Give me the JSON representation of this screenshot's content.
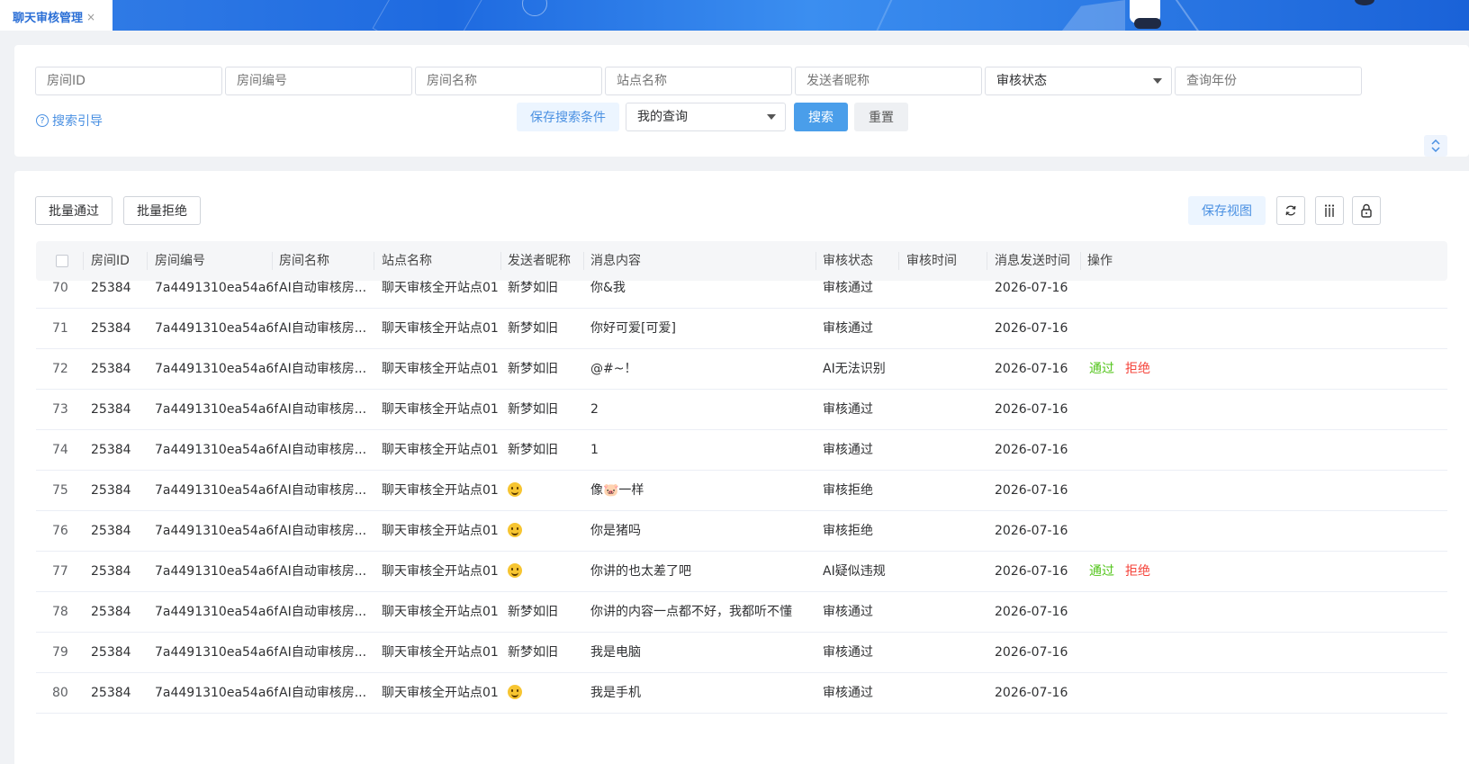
{
  "tab": {
    "title": "聊天审核管理",
    "close": "×"
  },
  "search": {
    "fields": [
      "房间ID",
      "房间编号",
      "房间名称",
      "站点名称",
      "发送者昵称",
      "审核状态",
      "查询年份"
    ],
    "guide": "搜索引导",
    "save_conditions": "保存搜索条件",
    "my_query": "我的查询",
    "search_button": "搜索",
    "reset_button": "重置",
    "collapse": "⌃⌄"
  },
  "toolbar": {
    "batch_pass": "批量通过",
    "batch_reject": "批量拒绝",
    "save_view": "保存视图"
  },
  "table": {
    "headers": [
      "房间ID",
      "房间编号",
      "房间名称",
      "站点名称",
      "发送者昵称",
      "消息内容",
      "审核状态",
      "审核时间",
      "消息发送时间",
      "操作"
    ],
    "actions": {
      "pass": "通过",
      "reject": "拒绝"
    },
    "rows": [
      {
        "idx": "70",
        "room_id": "25384",
        "room_no": "7a4491310ea54a6f",
        "room_name": "AI自动审核房...",
        "site": "聊天审核全开站点01",
        "sender": "新梦如旧",
        "sender_emoji": false,
        "content": "你&我",
        "status": "审核通过",
        "audit_time": "",
        "send_time": "2026-07-16",
        "has_actions": false
      },
      {
        "idx": "71",
        "room_id": "25384",
        "room_no": "7a4491310ea54a6f",
        "room_name": "AI自动审核房...",
        "site": "聊天审核全开站点01",
        "sender": "新梦如旧",
        "sender_emoji": false,
        "content": "你好可爱[可爱]",
        "status": "审核通过",
        "audit_time": "",
        "send_time": "2026-07-16",
        "has_actions": false
      },
      {
        "idx": "72",
        "room_id": "25384",
        "room_no": "7a4491310ea54a6f",
        "room_name": "AI自动审核房...",
        "site": "聊天审核全开站点01",
        "sender": "新梦如旧",
        "sender_emoji": false,
        "content": "@#~！",
        "status": "AI无法识别",
        "audit_time": "",
        "send_time": "2026-07-16",
        "has_actions": true
      },
      {
        "idx": "73",
        "room_id": "25384",
        "room_no": "7a4491310ea54a6f",
        "room_name": "AI自动审核房...",
        "site": "聊天审核全开站点01",
        "sender": "新梦如旧",
        "sender_emoji": false,
        "content": "2",
        "status": "审核通过",
        "audit_time": "",
        "send_time": "2026-07-16",
        "has_actions": false
      },
      {
        "idx": "74",
        "room_id": "25384",
        "room_no": "7a4491310ea54a6f",
        "room_name": "AI自动审核房...",
        "site": "聊天审核全开站点01",
        "sender": "新梦如旧",
        "sender_emoji": false,
        "content": "1",
        "status": "审核通过",
        "audit_time": "",
        "send_time": "2026-07-16",
        "has_actions": false
      },
      {
        "idx": "75",
        "room_id": "25384",
        "room_no": "7a4491310ea54a6f",
        "room_name": "AI自动审核房...",
        "site": "聊天审核全开站点01",
        "sender": "",
        "sender_emoji": true,
        "content": "像🐷一样",
        "status": "审核拒绝",
        "audit_time": "",
        "send_time": "2026-07-16",
        "has_actions": false
      },
      {
        "idx": "76",
        "room_id": "25384",
        "room_no": "7a4491310ea54a6f",
        "room_name": "AI自动审核房...",
        "site": "聊天审核全开站点01",
        "sender": "",
        "sender_emoji": true,
        "content": "你是猪吗",
        "status": "审核拒绝",
        "audit_time": "",
        "send_time": "2026-07-16",
        "has_actions": false
      },
      {
        "idx": "77",
        "room_id": "25384",
        "room_no": "7a4491310ea54a6f",
        "room_name": "AI自动审核房...",
        "site": "聊天审核全开站点01",
        "sender": "",
        "sender_emoji": true,
        "content": "你讲的也太差了吧",
        "status": "AI疑似违规",
        "audit_time": "",
        "send_time": "2026-07-16",
        "has_actions": true
      },
      {
        "idx": "78",
        "room_id": "25384",
        "room_no": "7a4491310ea54a6f",
        "room_name": "AI自动审核房...",
        "site": "聊天审核全开站点01",
        "sender": "新梦如旧",
        "sender_emoji": false,
        "content": "你讲的内容一点都不好，我都听不懂",
        "status": "审核通过",
        "audit_time": "",
        "send_time": "2026-07-16",
        "has_actions": false
      },
      {
        "idx": "79",
        "room_id": "25384",
        "room_no": "7a4491310ea54a6f",
        "room_name": "AI自动审核房...",
        "site": "聊天审核全开站点01",
        "sender": "新梦如旧",
        "sender_emoji": false,
        "content": "我是电脑",
        "status": "审核通过",
        "audit_time": "",
        "send_time": "2026-07-16",
        "has_actions": false
      },
      {
        "idx": "80",
        "room_id": "25384",
        "room_no": "7a4491310ea54a6f",
        "room_name": "AI自动审核房...",
        "site": "聊天审核全开站点01",
        "sender": "",
        "sender_emoji": true,
        "content": "我是手机",
        "status": "审核通过",
        "audit_time": "",
        "send_time": "2026-07-16",
        "has_actions": false
      }
    ]
  },
  "colors": {
    "primary": "#4a9eea",
    "pass": "#52c41a",
    "reject": "#f5433a",
    "link": "#4a90e2"
  }
}
